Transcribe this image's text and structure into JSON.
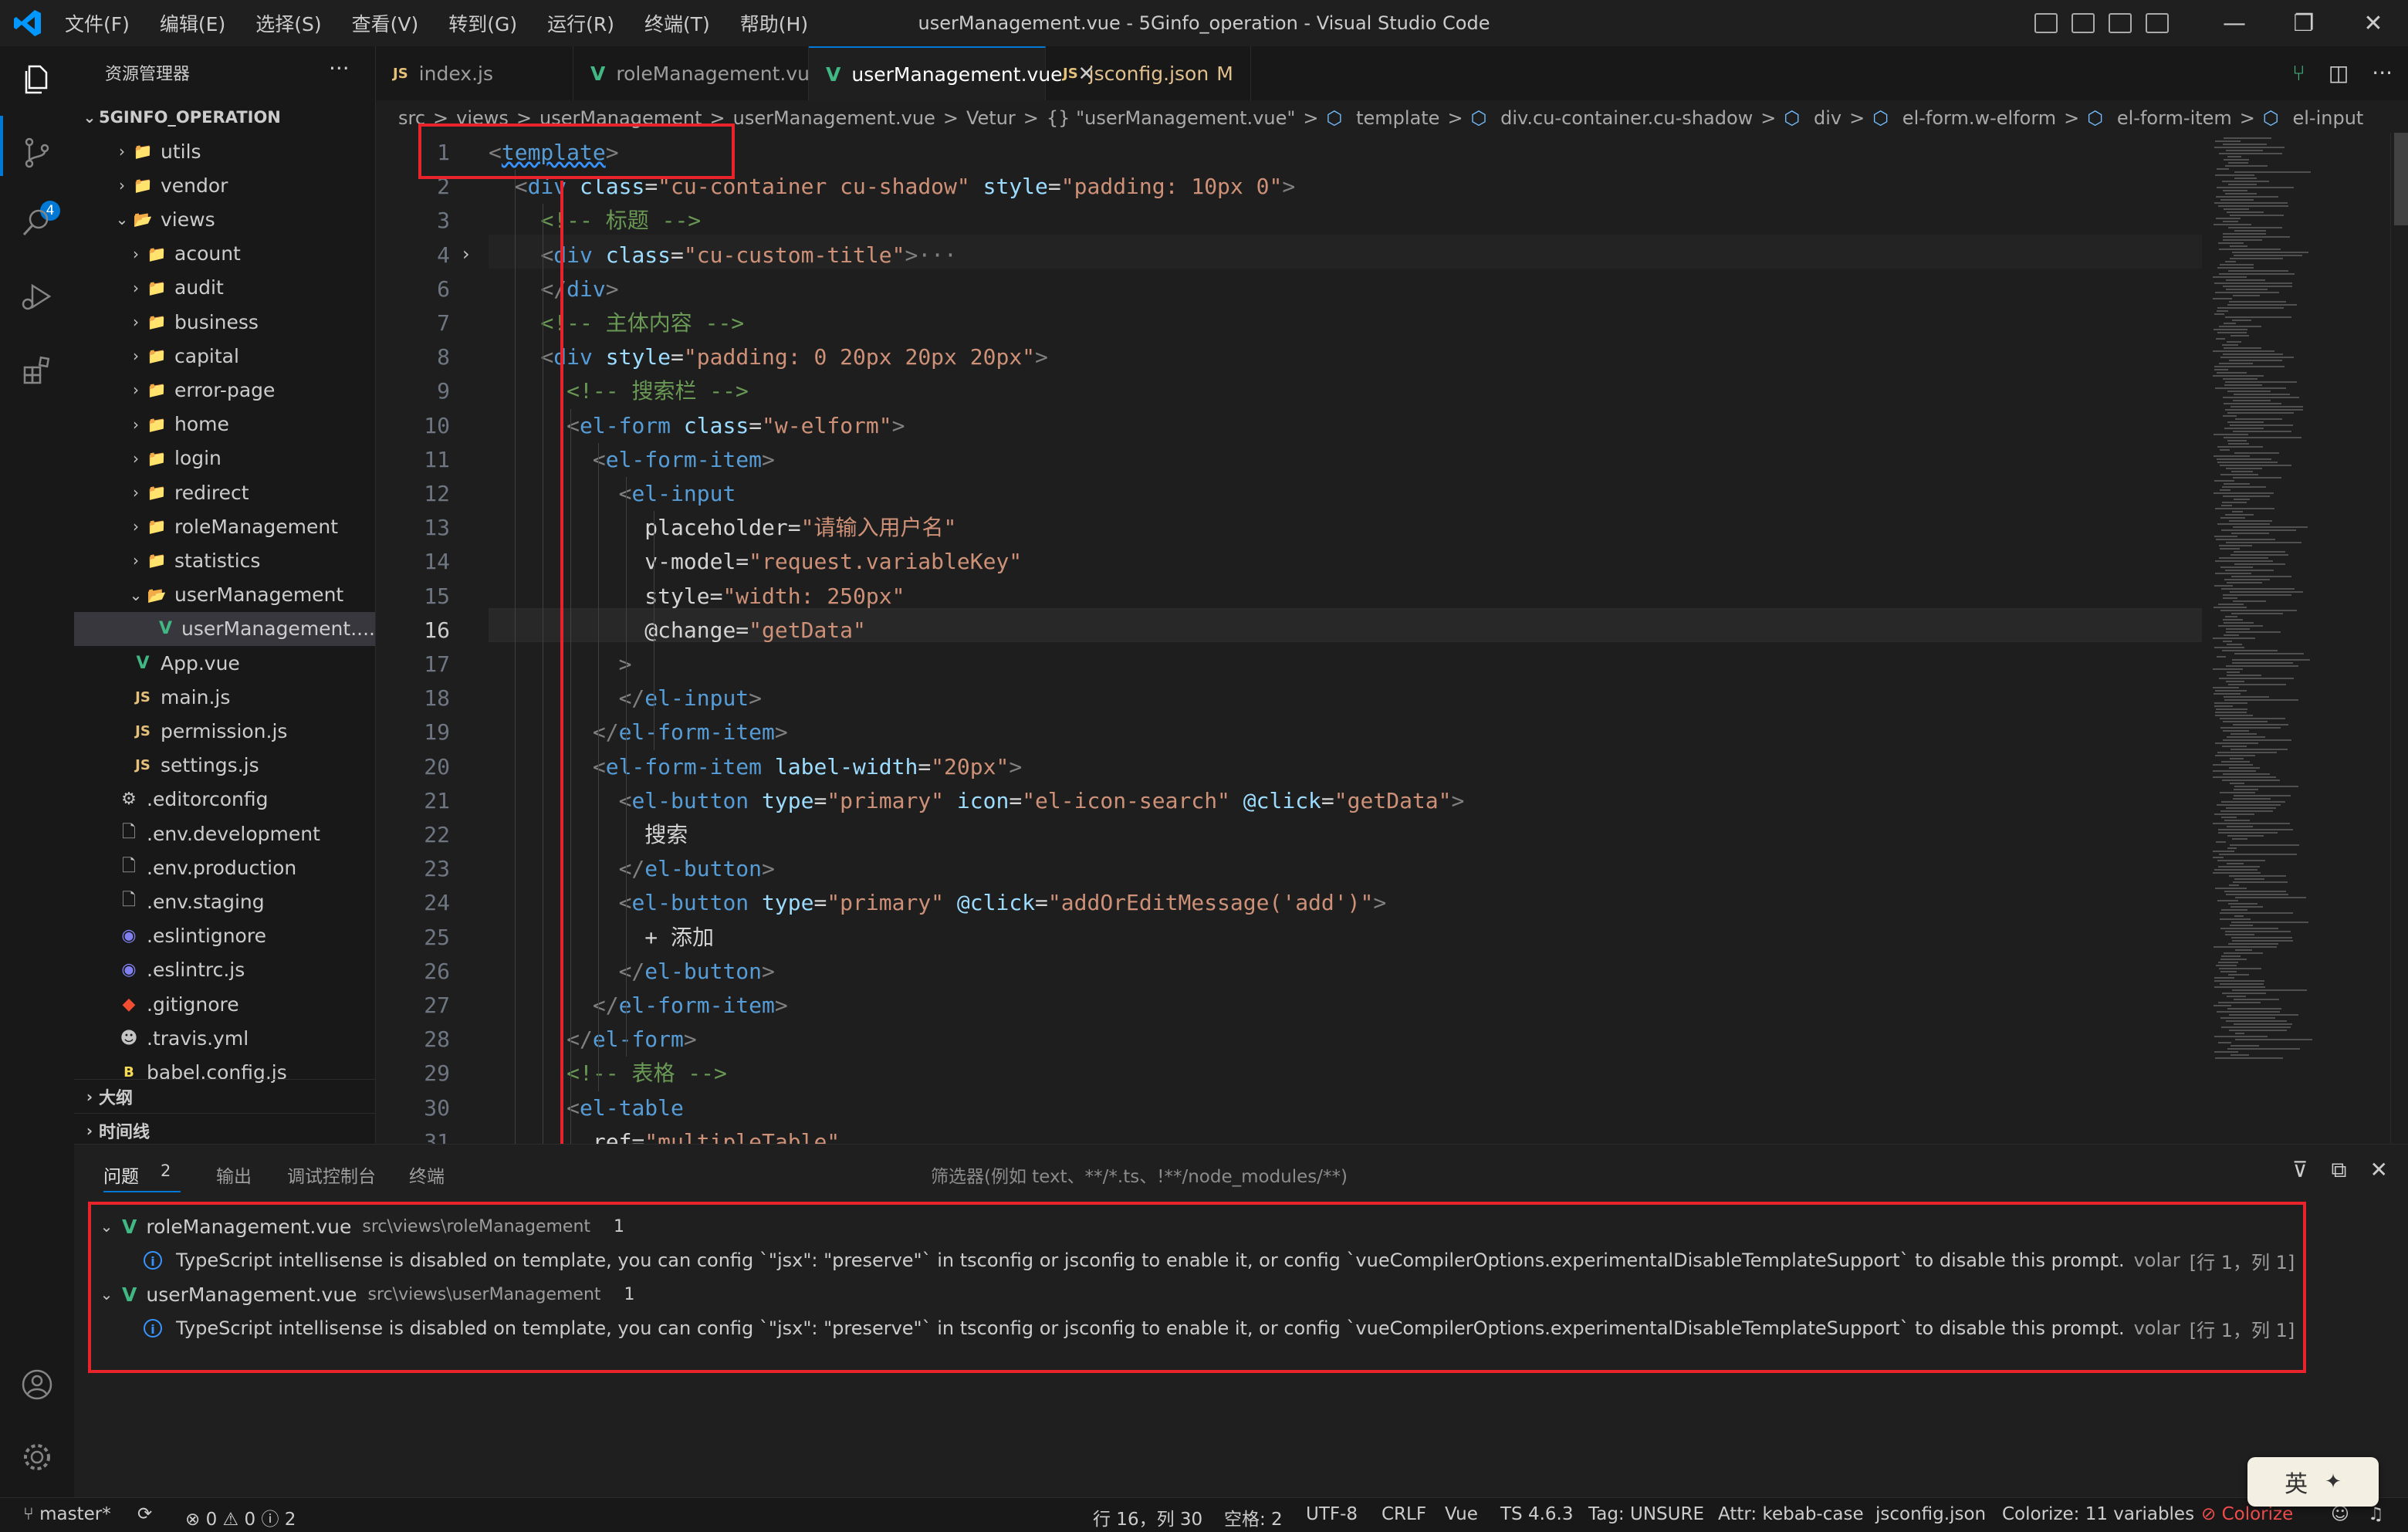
{
  "window": {
    "title": "userManagement.vue - 5Ginfo_operation - Visual Studio Code",
    "menu": [
      "文件(F)",
      "编辑(E)",
      "选择(S)",
      "查看(V)",
      "转到(G)",
      "运行(R)",
      "终端(T)",
      "帮助(H)"
    ],
    "controls": [
      "—",
      "❐",
      "✕"
    ]
  },
  "activity_bar": {
    "scm_badge": "4"
  },
  "sidebar": {
    "header": "资源管理器",
    "more": "···",
    "root": "5GINFO_OPERATION",
    "items": [
      {
        "label": "utils",
        "type": "folder",
        "indent": 2,
        "chev": "›"
      },
      {
        "label": "vendor",
        "type": "folder",
        "indent": 2,
        "chev": "›"
      },
      {
        "label": "views",
        "type": "folder-open",
        "indent": 2,
        "chev": "⌄"
      },
      {
        "label": "acount",
        "type": "folder",
        "indent": 3,
        "chev": "›"
      },
      {
        "label": "audit",
        "type": "folder",
        "indent": 3,
        "chev": "›"
      },
      {
        "label": "business",
        "type": "folder",
        "indent": 3,
        "chev": "›"
      },
      {
        "label": "capital",
        "type": "folder",
        "indent": 3,
        "chev": "›"
      },
      {
        "label": "error-page",
        "type": "folder",
        "indent": 3,
        "chev": "›"
      },
      {
        "label": "home",
        "type": "folder",
        "indent": 3,
        "chev": "›"
      },
      {
        "label": "login",
        "type": "folder",
        "indent": 3,
        "chev": "›"
      },
      {
        "label": "redirect",
        "type": "folder",
        "indent": 3,
        "chev": "›"
      },
      {
        "label": "roleManagement",
        "type": "folder",
        "indent": 3,
        "chev": "›"
      },
      {
        "label": "statistics",
        "type": "folder",
        "indent": 3,
        "chev": "›"
      },
      {
        "label": "userManagement",
        "type": "folder-open",
        "indent": 3,
        "chev": "⌄"
      },
      {
        "label": "userManagement....",
        "type": "vue",
        "indent": 4,
        "chev": "",
        "selected": true
      },
      {
        "label": "App.vue",
        "type": "vue",
        "indent": 2,
        "chev": ""
      },
      {
        "label": "main.js",
        "type": "js",
        "indent": 2,
        "chev": ""
      },
      {
        "label": "permission.js",
        "type": "js",
        "indent": 2,
        "chev": ""
      },
      {
        "label": "settings.js",
        "type": "js",
        "indent": 2,
        "chev": ""
      },
      {
        "label": ".editorconfig",
        "type": "config",
        "indent": 1,
        "chev": ""
      },
      {
        "label": ".env.development",
        "type": "file",
        "indent": 1,
        "chev": ""
      },
      {
        "label": ".env.production",
        "type": "file",
        "indent": 1,
        "chev": ""
      },
      {
        "label": ".env.staging",
        "type": "file",
        "indent": 1,
        "chev": ""
      },
      {
        "label": ".eslintignore",
        "type": "eslint",
        "indent": 1,
        "chev": ""
      },
      {
        "label": ".eslintrc.js",
        "type": "eslint",
        "indent": 1,
        "chev": ""
      },
      {
        "label": ".gitignore",
        "type": "git",
        "indent": 1,
        "chev": ""
      },
      {
        "label": ".travis.yml",
        "type": "travis",
        "indent": 1,
        "chev": ""
      },
      {
        "label": "babel.config.js",
        "type": "babel",
        "indent": 1,
        "chev": ""
      }
    ],
    "outline": "大纲",
    "timeline": "时间线"
  },
  "tabs": [
    {
      "label": "index.js",
      "icon": "JS",
      "kind": "js"
    },
    {
      "label": "roleManagement.vue",
      "icon": "V",
      "kind": "vue"
    },
    {
      "label": "userManagement.vue",
      "icon": "V",
      "kind": "vue",
      "active": true,
      "close": "✕"
    },
    {
      "label": "jsconfig.json",
      "icon": "JS",
      "kind": "js",
      "modified": "M"
    }
  ],
  "breadcrumb": [
    "src",
    ">",
    "views",
    ">",
    "userManagement",
    ">",
    "userManagement.vue",
    ">",
    "Vetur",
    ">",
    "{} \"userManagement.vue\"",
    ">",
    "template",
    ">",
    "div.cu-container.cu-shadow",
    ">",
    "div",
    ">",
    "el-form.w-elform",
    ">",
    "el-form-item",
    ">",
    "el-input"
  ],
  "editor": {
    "current_line": "16",
    "lines": [
      {
        "n": "1",
        "code": "<template>"
      },
      {
        "n": "2",
        "code": "  <div class=\"cu-container cu-shadow\" style=\"padding: 10px 0\">"
      },
      {
        "n": "3",
        "code": "    <!-- 标题 -->"
      },
      {
        "n": "4",
        "code": "    <div class=\"cu-custom-title\">···"
      },
      {
        "n": "6",
        "code": "    </div>"
      },
      {
        "n": "7",
        "code": "    <!-- 主体内容 -->"
      },
      {
        "n": "8",
        "code": "    <div style=\"padding: 0 20px 20px 20px\">"
      },
      {
        "n": "9",
        "code": "      <!-- 搜索栏 -->"
      },
      {
        "n": "10",
        "code": "      <el-form class=\"w-elform\">"
      },
      {
        "n": "11",
        "code": "        <el-form-item>"
      },
      {
        "n": "12",
        "code": "          <el-input"
      },
      {
        "n": "13",
        "code": "            placeholder=\"请输入用户名\""
      },
      {
        "n": "14",
        "code": "            v-model=\"request.variableKey\""
      },
      {
        "n": "15",
        "code": "            style=\"width: 250px\""
      },
      {
        "n": "16",
        "code": "            @change=\"getData\""
      },
      {
        "n": "17",
        "code": "          >"
      },
      {
        "n": "18",
        "code": "          </el-input>"
      },
      {
        "n": "19",
        "code": "        </el-form-item>"
      },
      {
        "n": "20",
        "code": "        <el-form-item label-width=\"20px\">"
      },
      {
        "n": "21",
        "code": "          <el-button type=\"primary\" icon=\"el-icon-search\" @click=\"getData\">"
      },
      {
        "n": "22",
        "code": "            搜索"
      },
      {
        "n": "23",
        "code": "          </el-button>"
      },
      {
        "n": "24",
        "code": "          <el-button type=\"primary\" @click=\"addOrEditMessage('add')\">"
      },
      {
        "n": "25",
        "code": "            + 添加"
      },
      {
        "n": "26",
        "code": "          </el-button>"
      },
      {
        "n": "27",
        "code": "        </el-form-item>"
      },
      {
        "n": "28",
        "code": "      </el-form>"
      },
      {
        "n": "29",
        "code": "      <!-- 表格 -->"
      },
      {
        "n": "30",
        "code": "      <el-table"
      },
      {
        "n": "31",
        "code": "        ref=\"multipleTable\""
      }
    ]
  },
  "panel": {
    "tabs": [
      "问题",
      "输出",
      "调试控制台",
      "终端"
    ],
    "problems_count": "2",
    "filter_placeholder": "筛选器(例如 text、**/*.ts、!**/node_modules/**)",
    "groups": [
      {
        "file": "roleManagement.vue",
        "path": "src\\views\\roleManagement",
        "count": "1",
        "message": "TypeScript intellisense is disabled on template, you can config `\"jsx\": \"preserve\"` in tsconfig or jsconfig to enable it, or config `vueCompilerOptions.experimentalDisableTemplateSupport` to disable this prompt.",
        "source": "volar",
        "location": "[行 1，列 1]"
      },
      {
        "file": "userManagement.vue",
        "path": "src\\views\\userManagement",
        "count": "1",
        "message": "TypeScript intellisense is disabled on template, you can config `\"jsx\": \"preserve\"` in tsconfig or jsconfig to enable it, or config `vueCompilerOptions.experimentalDisableTemplateSupport` to disable this prompt.",
        "source": "volar",
        "location": "[行 1，列 1]"
      }
    ]
  },
  "status": {
    "branch": "master*",
    "errors": "0",
    "warnings": "0",
    "infos": "2",
    "position": "行 16，列 30",
    "spaces": "空格: 2",
    "encoding": "UTF-8",
    "eol": "CRLF",
    "language": "Vue",
    "ts": "TS 4.6.3",
    "tag": "Tag: UNSURE",
    "attr": "Attr: kebab-case",
    "config": "jsconfig.json",
    "colorize": "Colorize: 11 variables",
    "colorize_btn": "Colorize"
  },
  "ime": {
    "label": "英"
  },
  "colors": {
    "accent": "#0078d4",
    "annotation_red": "#e8232b",
    "tag": "#569cd6",
    "attr": "#9cdcfe",
    "string": "#ce9178",
    "comment": "#6a9955"
  }
}
